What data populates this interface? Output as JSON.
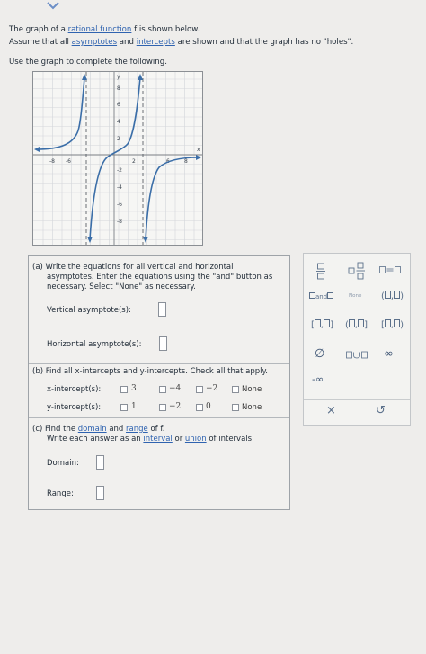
{
  "intro": {
    "line1_a": "The graph of a ",
    "line1_link": "rational function",
    "line1_b": " f is shown below.",
    "line2_a": "Assume that all ",
    "line2_link1": "asymptotes",
    "line2_and": " and ",
    "line2_link2": "intercepts",
    "line2_b": " are shown and that the graph has no \"holes\".",
    "line3": "Use the graph to complete the following."
  },
  "graph": {
    "x_ticks": [
      "-8",
      "-6",
      "2",
      "6",
      "8"
    ],
    "y_ticks": [
      "8",
      "6",
      "4",
      "2",
      "-2",
      "-4",
      "-6",
      "-8"
    ],
    "x_axis_label": "x",
    "y_axis_label": "y"
  },
  "part_a": {
    "line1": "(a) Write the equations for all vertical and horizontal",
    "line2": "asymptotes. Enter the equations using the \"and\" button as",
    "line3": "necessary. Select \"None\" as necessary.",
    "vertical_label": "Vertical asymptote(s):",
    "horizontal_label": "Horizontal asymptote(s):"
  },
  "part_b": {
    "heading": "(b) Find all x-intercepts and y-intercepts. Check all that apply.",
    "x_label": "x-intercept(s):",
    "x_options": [
      "3",
      "−4",
      "−2",
      "None"
    ],
    "y_label": "y-intercept(s):",
    "y_options": [
      "1",
      "−2",
      "0",
      "None"
    ]
  },
  "part_c": {
    "line1_a": "(c) Find the ",
    "line1_link1": "domain",
    "line1_and": " and ",
    "line1_link2": "range",
    "line1_b": " of f.",
    "line2_a": "Write each answer as an ",
    "line2_link1": "interval",
    "line2_or": " or ",
    "line2_link2": "union",
    "line2_b": " of intervals.",
    "domain_label": "Domain:",
    "range_label": "Range:"
  },
  "keypad": {
    "and_label": "and",
    "none_label": "None",
    "empty_set": "∅",
    "infinity": "∞",
    "neg_infinity": "-∞",
    "clear": "×",
    "undo": "↺"
  }
}
